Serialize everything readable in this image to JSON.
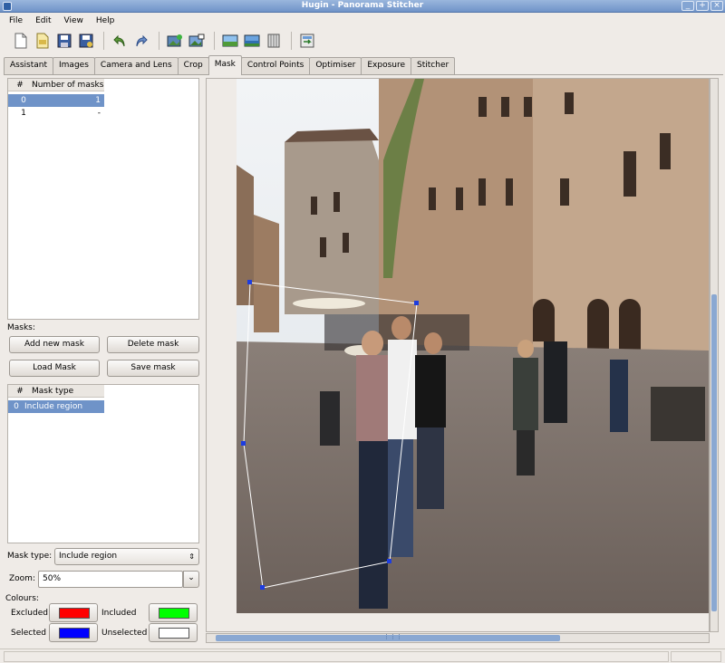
{
  "window": {
    "title": "Hugin - Panorama Stitcher",
    "buttons": [
      "_",
      "+",
      "×"
    ]
  },
  "menu": [
    "File",
    "Edit",
    "View",
    "Help"
  ],
  "toolbar": {
    "icons": [
      "new-project-icon",
      "open-project-icon",
      "save-icon",
      "save-as-icon",
      "undo-icon",
      "redo-icon",
      "add-images-icon",
      "add-time-series-icon",
      "preview-icon",
      "fast-preview-icon",
      "layout-icon",
      "stitch-icon"
    ]
  },
  "tabs": [
    "Assistant",
    "Images",
    "Camera and Lens",
    "Crop",
    "Mask",
    "Control Points",
    "Optimiser",
    "Exposure",
    "Stitcher"
  ],
  "active_tab": "Mask",
  "images_list": {
    "col_num": "#",
    "col_masks": "Number of masks",
    "rows": [
      {
        "num": "0",
        "masks": "1",
        "selected": true
      },
      {
        "num": "1",
        "masks": "-",
        "selected": false
      }
    ]
  },
  "masks_label": "Masks:",
  "buttons": {
    "add_new_mask": "Add new mask",
    "delete_mask": "Delete mask",
    "load_mask": "Load Mask",
    "save_mask": "Save mask"
  },
  "mask_list": {
    "col_num": "#",
    "col_type": "Mask type",
    "rows": [
      {
        "num": "0",
        "type": "Include region",
        "selected": true
      }
    ]
  },
  "mask_type": {
    "label": "Mask type:",
    "value": "Include region"
  },
  "zoom": {
    "label": "Zoom:",
    "value": "50%"
  },
  "colours": {
    "label": "Colours:",
    "excluded_label": "Excluded",
    "excluded_color": "#ff0000",
    "included_label": "Included",
    "included_color": "#00ff00",
    "selected_label": "Selected",
    "selected_color": "#0000ff",
    "unselected_label": "Unselected",
    "unselected_color": "#ffffff"
  },
  "scrollbar_grip": "⋮⋮⋮"
}
